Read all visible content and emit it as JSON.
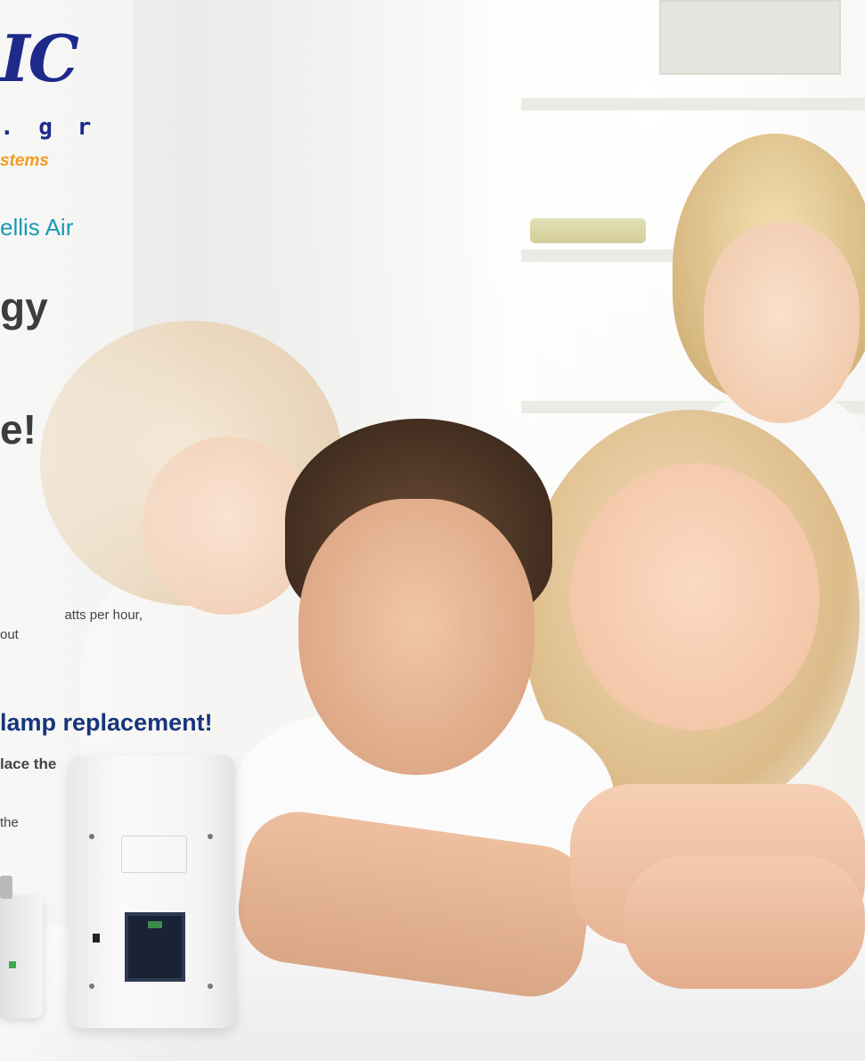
{
  "logo": {
    "word": "IC",
    "domain": ". g r",
    "tagline": "stems"
  },
  "brand_line": "ellis Air",
  "headline": {
    "line1": "gy",
    "line2": "e!"
  },
  "body": {
    "line1": "atts per hour,",
    "line2": "out"
  },
  "highlight": "lamp replacement!",
  "bold_line": "lace the",
  "small_line": "the",
  "colors": {
    "logo_blue": "#1d2a8c",
    "tag_orange": "#f39a1c",
    "brand_teal": "#1a9ab6",
    "highlight_navy": "#17357a"
  }
}
